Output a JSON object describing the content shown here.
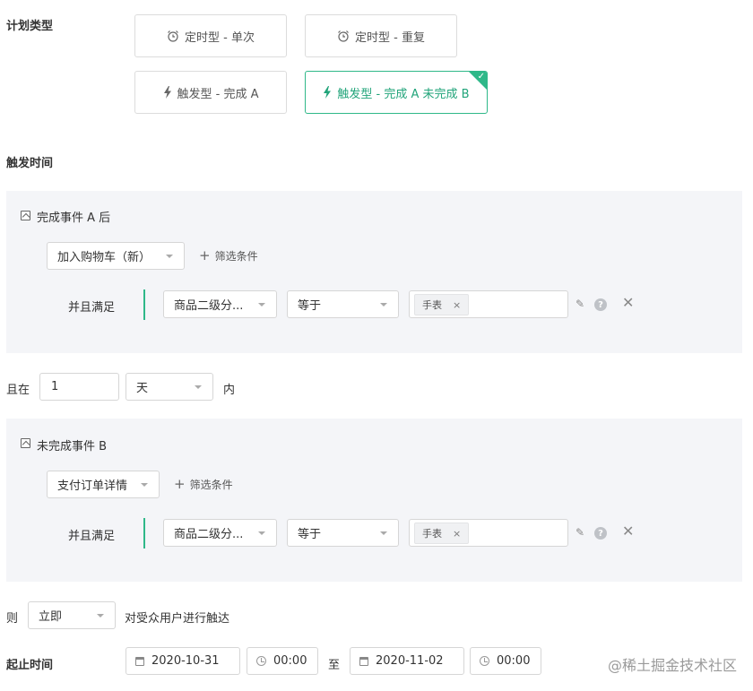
{
  "plan_type": {
    "label": "计划类型",
    "options": [
      {
        "label": "定时型 - 单次",
        "icon": "alarm-clock-icon"
      },
      {
        "label": "定时型 - 重复",
        "icon": "alarm-clock-icon"
      },
      {
        "label": "触发型 - 完成 A",
        "icon": "lightning-icon"
      },
      {
        "label": "触发型 - 完成 A 未完成 B",
        "icon": "lightning-icon",
        "selected": true
      }
    ]
  },
  "trigger_time": {
    "label": "触发时间"
  },
  "event_a": {
    "title": "完成事件 A 后",
    "event_select": "加入购物车（新）",
    "add_filter": "筛选条件",
    "condition": {
      "label": "并且满足",
      "property": "商品二级分...",
      "operator": "等于",
      "tag": "手表",
      "tag_remove": "×"
    }
  },
  "window": {
    "prefix": "且在",
    "value": "1",
    "unit": "天",
    "suffix": "内"
  },
  "event_b": {
    "title": "未完成事件 B",
    "event_select": "支付订单详情",
    "add_filter": "筛选条件",
    "condition": {
      "label": "并且满足",
      "property": "商品二级分...",
      "operator": "等于",
      "tag": "手表",
      "tag_remove": "×"
    }
  },
  "action": {
    "prefix": "则",
    "timing": "立即",
    "suffix": "对受众用户进行触达"
  },
  "schedule": {
    "label": "起止时间",
    "start_date": "2020-10-31",
    "start_time": "00:00",
    "separator": "至",
    "end_date": "2020-11-02",
    "end_time": "00:00"
  },
  "watermark": "@稀土掘金技术社区",
  "colors": {
    "accent": "#2fb889",
    "panel": "#f4f5f8"
  }
}
